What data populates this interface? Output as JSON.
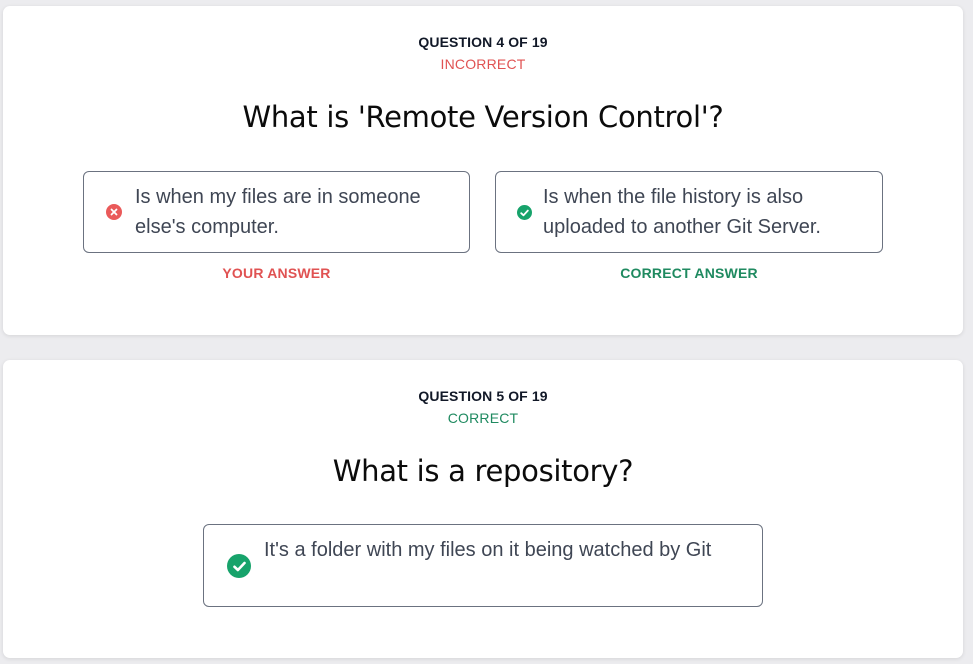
{
  "questions": [
    {
      "number_label": "QUESTION 4 OF 19",
      "status": "INCORRECT",
      "title": "What is 'Remote Version Control'?",
      "answers": [
        {
          "text": "Is when my files are in someone else's computer.",
          "caption": "YOUR ANSWER",
          "icon": "x-circle-icon",
          "state": "incorrect"
        },
        {
          "text": "Is when the file history is also uploaded to another Git Server.",
          "caption": "CORRECT ANSWER",
          "icon": "check-circle-icon",
          "state": "correct"
        }
      ]
    },
    {
      "number_label": "QUESTION 5 OF 19",
      "status": "CORRECT",
      "title": "What is a repository?",
      "answers": [
        {
          "text": "It's a folder with my files on it being watched by Git",
          "icon": "check-circle-icon",
          "state": "correct"
        }
      ]
    }
  ],
  "colors": {
    "incorrect": "#e05252",
    "correct": "#1f8a60",
    "correct_icon": "#17a36b",
    "incorrect_icon": "#ea5a5a"
  }
}
